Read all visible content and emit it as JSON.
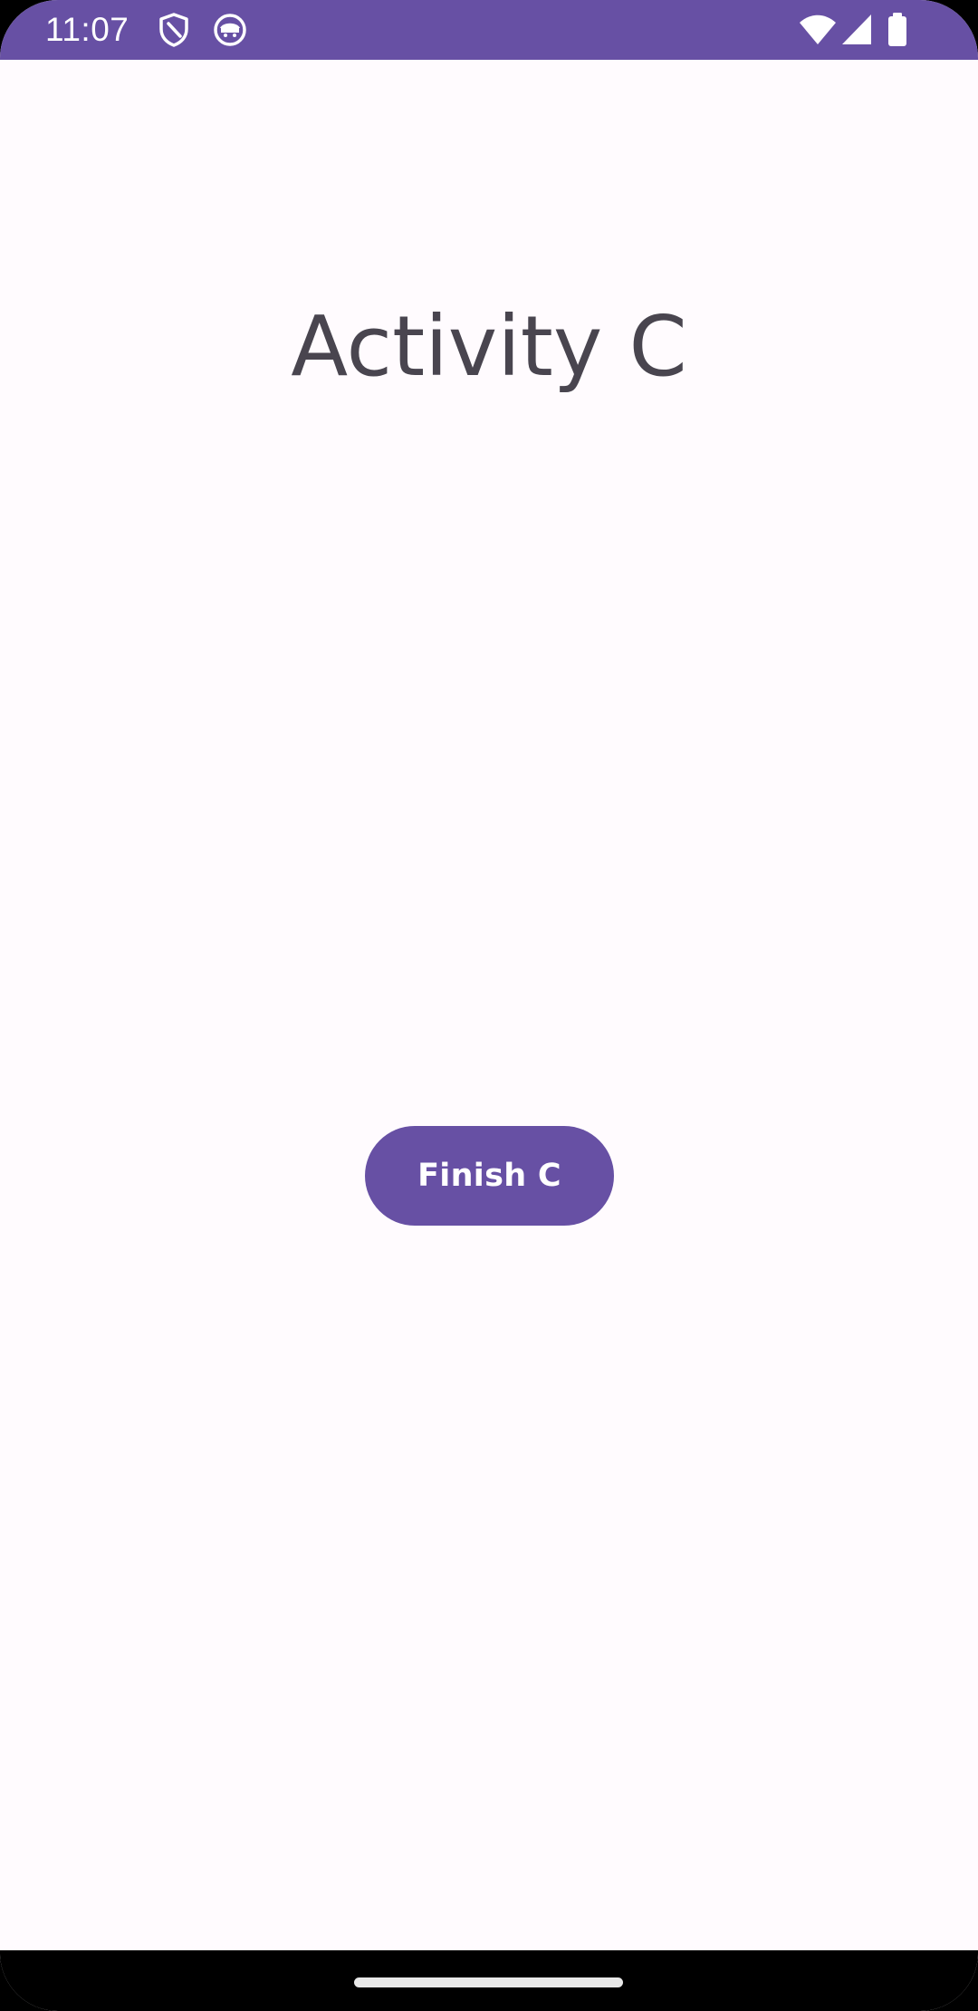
{
  "status_bar": {
    "time": "11:07",
    "color": "#6750A4",
    "left_icons": [
      "shield-icon",
      "robot-face-icon"
    ],
    "right_icons": [
      "wifi-icon",
      "cellular-signal-icon",
      "battery-icon"
    ]
  },
  "main": {
    "title": "Activity C",
    "finish_button_label": "Finish C",
    "button_color": "#6750A4",
    "background": "#FFFBFE",
    "title_color": "#49454F"
  },
  "nav_bar": {
    "handle_icon": "gesture-handle"
  }
}
